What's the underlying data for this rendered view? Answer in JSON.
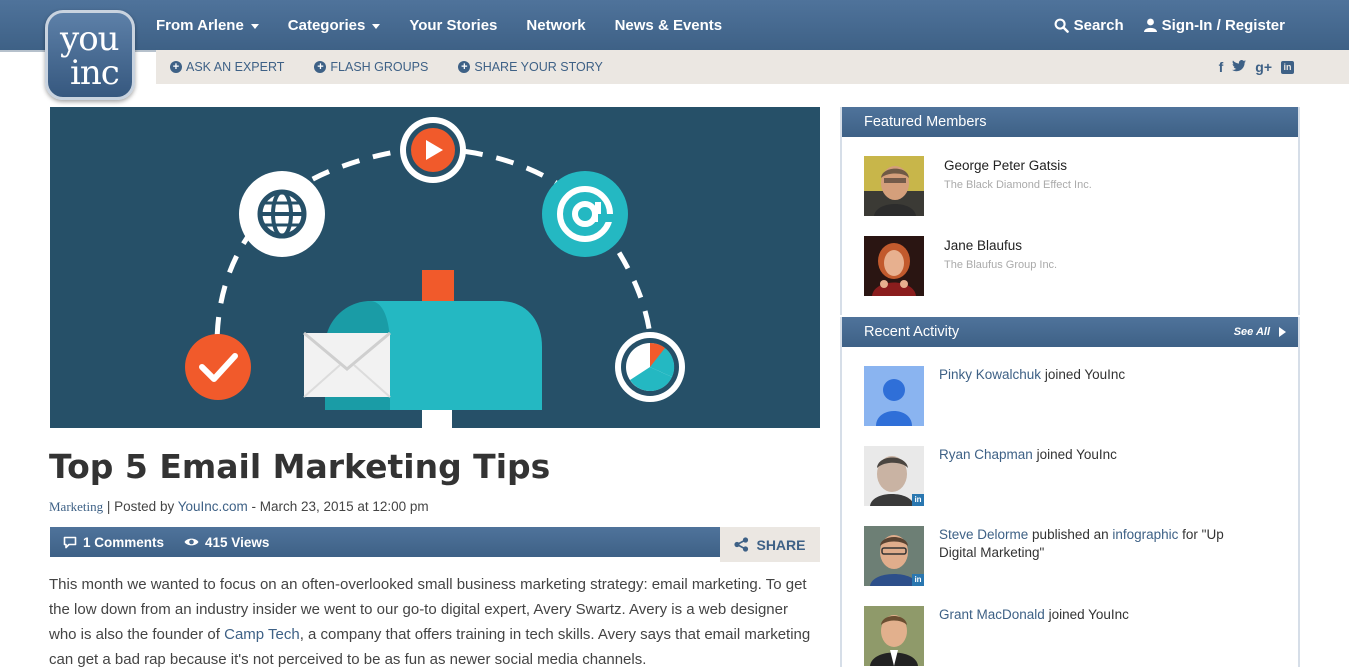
{
  "nav": {
    "items": [
      {
        "label": "From Arlene",
        "dropdown": true
      },
      {
        "label": "Categories",
        "dropdown": true
      },
      {
        "label": "Your Stories",
        "dropdown": false
      },
      {
        "label": "Network",
        "dropdown": false
      },
      {
        "label": "News & Events",
        "dropdown": false
      }
    ],
    "search_label": "Search",
    "signin_label": "Sign-In / Register"
  },
  "subnav": {
    "links": [
      "ASK AN EXPERT",
      "FLASH GROUPS",
      "SHARE YOUR STORY"
    ],
    "social_icons": [
      "facebook-icon",
      "twitter-icon",
      "google-plus-icon",
      "linkedin-icon"
    ]
  },
  "logo": {
    "line1": "you",
    "line2": "inc"
  },
  "article": {
    "title": "Top 5 Email Marketing Tips",
    "category": "Marketing",
    "posted_by_prefix": " | Posted by ",
    "author": "YouInc.com",
    "date": " - March 23, 2015 at 12:00 pm",
    "comments": "1 Comments",
    "views": "415 Views",
    "share_label": "SHARE",
    "body_1": "This month we wanted to focus on an often-overlooked small business marketing strategy: email marketing. To get the low down from an industry insider we went to our go-to digital expert, Avery Swartz. Avery is a web designer who is also the founder of ",
    "body_link": "Camp Tech",
    "body_2": ", a company that offers training in tech skills. Avery says that email marketing can get a bad rap because it's not perceived to be as fun as newer social media channels."
  },
  "featured": {
    "heading": "Featured Members",
    "members": [
      {
        "name": "George Peter Gatsis",
        "company": "The Black Diamond Effect Inc."
      },
      {
        "name": "Jane Blaufus",
        "company": "The Blaufus Group Inc."
      }
    ]
  },
  "activity": {
    "heading": "Recent Activity",
    "see_all": "See All",
    "items": [
      {
        "name": "Pinky Kowalchuk",
        "text": " joined YouInc",
        "link": "",
        "tail": ""
      },
      {
        "name": "Ryan Chapman",
        "text": " joined YouInc",
        "link": "",
        "tail": ""
      },
      {
        "name": "Steve Delorme",
        "text": " published an ",
        "link": "infographic",
        "tail": " for \"Up Digital Marketing\""
      },
      {
        "name": "Grant MacDonald",
        "text": " joined YouInc",
        "link": "",
        "tail": ""
      }
    ]
  },
  "colors": {
    "brand_blue": "#3e6186",
    "hero_bg": "#265068",
    "teal": "#24b8c2",
    "orange": "#f15a2b"
  }
}
